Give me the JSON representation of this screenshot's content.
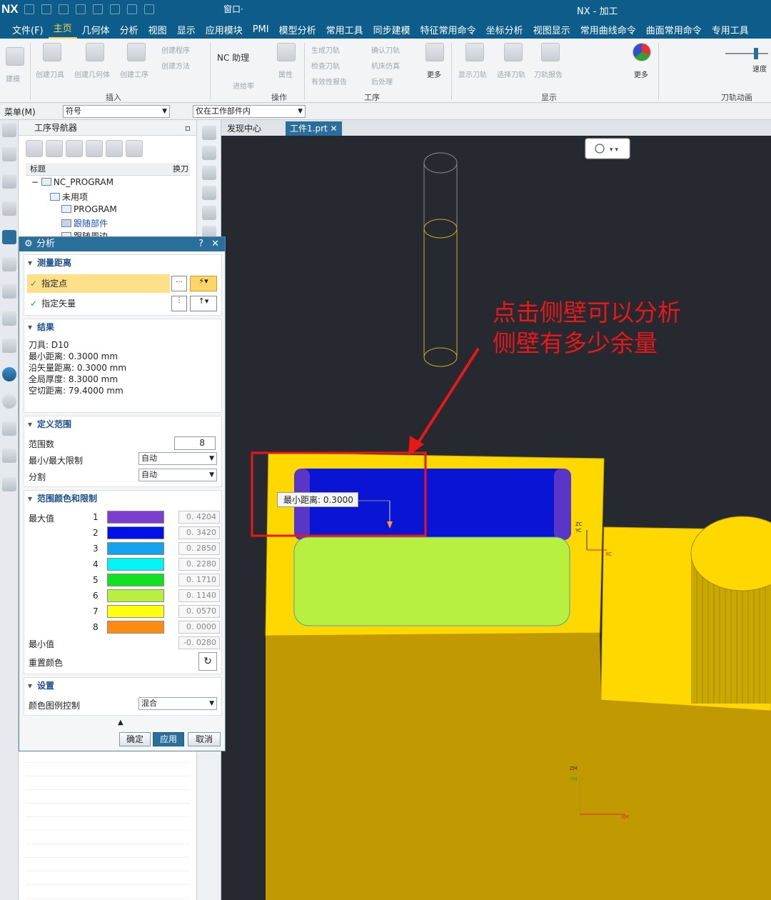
{
  "titlebar": {
    "logo": "NX",
    "window_menu": "窗口·",
    "title": "NX - 加工"
  },
  "menu": [
    "文件(F)",
    "主页",
    "几何体",
    "分析",
    "视图",
    "显示",
    "应用模块",
    "PMI",
    "模型分析",
    "常用工具",
    "同步建模",
    "特征常用命令",
    "坐标分析",
    "视图显示",
    "常用曲线命令",
    "曲面常用命令",
    "专用工具"
  ],
  "menu_active_index": 1,
  "ribbon": {
    "buttons": [
      "建模",
      "创建刀具",
      "创建几何体",
      "创建工序",
      "创建程序",
      "创建方法",
      "NC 助理",
      "属性",
      "进给率",
      "生成刀轨",
      "检查刀轨",
      "有效性报告",
      "确认刀轨",
      "机床仿真",
      "后处理",
      "更多",
      "显示刀轨",
      "选择刀轨",
      "刀轨报告",
      "更多",
      "速度"
    ],
    "groups": [
      "插入",
      "操作",
      "工序",
      "显示",
      "刀轨动画"
    ]
  },
  "toolbar2": {
    "menu_label": "菜单(M)",
    "filter_value": "符号",
    "scope_value": "仅在工作部件内"
  },
  "navigator": {
    "title": "工序导航器",
    "columns": [
      "标题",
      "换刀"
    ],
    "tree": [
      "NC_PROGRAM",
      "未用项",
      "PROGRAM",
      "跟随部件",
      "跟随周边"
    ]
  },
  "tabs": {
    "discover": "发现中心",
    "part": "工件1.prt"
  },
  "dialog": {
    "title": "分析",
    "measure": {
      "header": "测量距离",
      "specify_point": "指定点",
      "specify_vector": "指定矢量"
    },
    "results": {
      "header": "结果",
      "lines": [
        "刀具: D10",
        "最小距离: 0.3000 mm",
        "沿矢量距离: 0.3000 mm",
        "全局厚度: 8.3000 mm",
        "空切距离: 79.4000 mm"
      ]
    },
    "range": {
      "header": "定义范围",
      "count_label": "范围数",
      "count_value": "8",
      "limit_label": "最小/最大限制",
      "limit_value": "自动",
      "split_label": "分割",
      "split_value": "自动"
    },
    "colors": {
      "header": "范围颜色和限制",
      "max_label": "最大值",
      "min_label": "最小值",
      "min_value": "-0. 0280",
      "reset_label": "重置颜色",
      "rows": [
        {
          "index": "1",
          "color": "#7b3fd0",
          "value": "0. 4204"
        },
        {
          "index": "2",
          "color": "#0010e6",
          "value": "0. 3420"
        },
        {
          "index": "3",
          "color": "#15a3f0",
          "value": "0. 2850"
        },
        {
          "index": "4",
          "color": "#00f5f5",
          "value": "0. 2280"
        },
        {
          "index": "5",
          "color": "#10e020",
          "value": "0. 1710"
        },
        {
          "index": "6",
          "color": "#b8f040",
          "value": "0. 1140"
        },
        {
          "index": "7",
          "color": "#ffff10",
          "value": "0. 0570"
        },
        {
          "index": "8",
          "color": "#ff8c10",
          "value": "0. 0000"
        }
      ]
    },
    "settings": {
      "header": "设置",
      "legend_label": "颜色图例控制",
      "legend_value": "混合"
    },
    "buttons": {
      "ok": "确定",
      "apply": "应用",
      "cancel": "取消"
    }
  },
  "viewport": {
    "tooltip": "最小距离: 0.3000",
    "annotation": [
      "点击侧壁可以分析",
      "侧壁有多少余量"
    ],
    "axis_labels": {
      "zc": "ZC",
      "yc": "YC",
      "xc": "XC",
      "zm": "ZM",
      "ym": "YM",
      "xm": "XM"
    },
    "colors": {
      "part_yellow": "#ffd800",
      "lower_face": "#c09a00",
      "wall_blue": "#0a14d4",
      "floor_green": "#b8f040",
      "annotation_red": "#e81818"
    }
  }
}
